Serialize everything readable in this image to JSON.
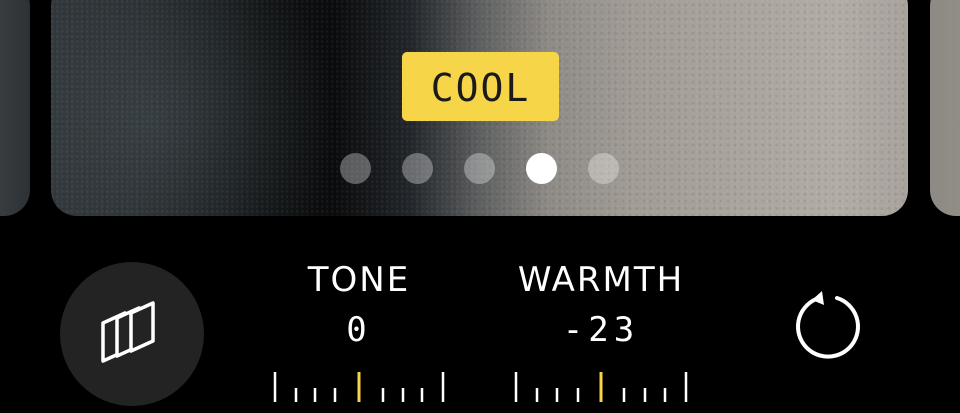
{
  "photographic_styles": {
    "current_style_label": "COOL",
    "page_count": 5,
    "active_page": 4,
    "label_color": "#f6d548"
  },
  "controls": {
    "styles_button_icon": "photographic-styles-icon",
    "reset_icon": "reset-icon",
    "tone": {
      "name": "TONE",
      "value": "0"
    },
    "warmth": {
      "name": "WARMTH",
      "value": "-23"
    },
    "ruler_center_color": "#f6d548",
    "ruler_tick_color": "#ffffff"
  }
}
